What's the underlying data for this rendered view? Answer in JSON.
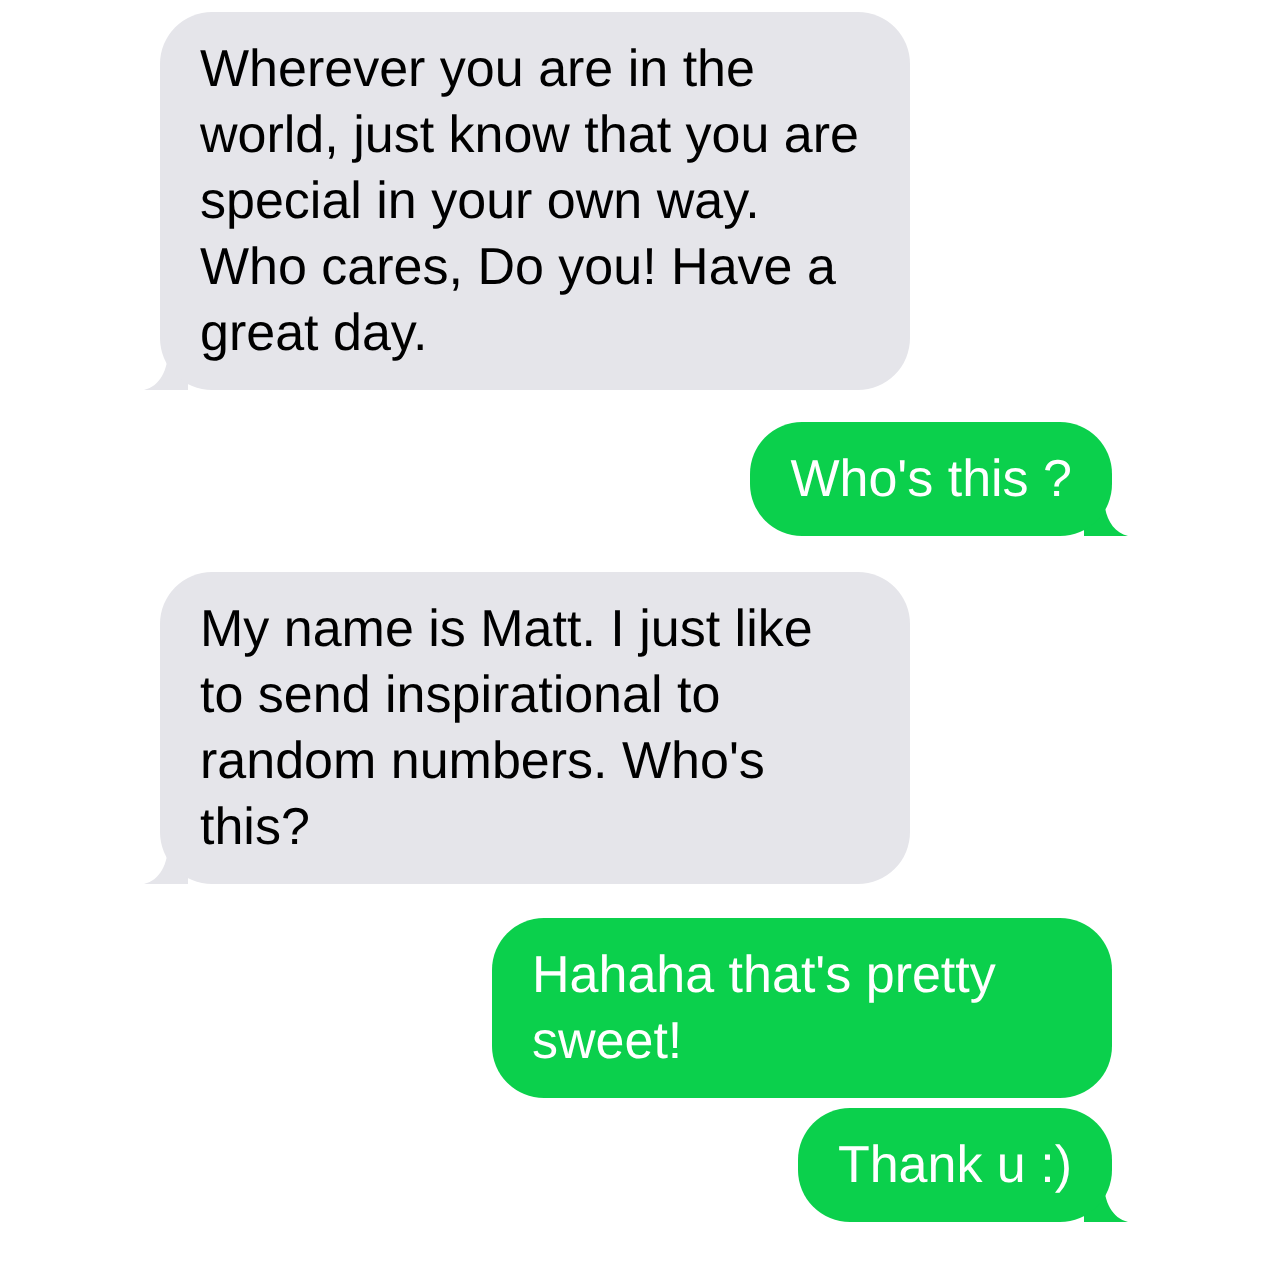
{
  "messages": [
    {
      "kind": "incoming",
      "tail": true,
      "text": "Wherever you are in the world, just know that you are special in your own way. Who cares, Do you! Have a great day."
    },
    {
      "kind": "outgoing",
      "tail": true,
      "text": "Who's this ?"
    },
    {
      "kind": "incoming",
      "tail": true,
      "text": "My name is Matt. I just like to send inspirational to random numbers. Who's this?"
    },
    {
      "kind": "outgoing",
      "tail": false,
      "text": "Hahaha that's pretty sweet!"
    },
    {
      "kind": "outgoing",
      "tail": true,
      "text": "Thank u :)"
    }
  ]
}
